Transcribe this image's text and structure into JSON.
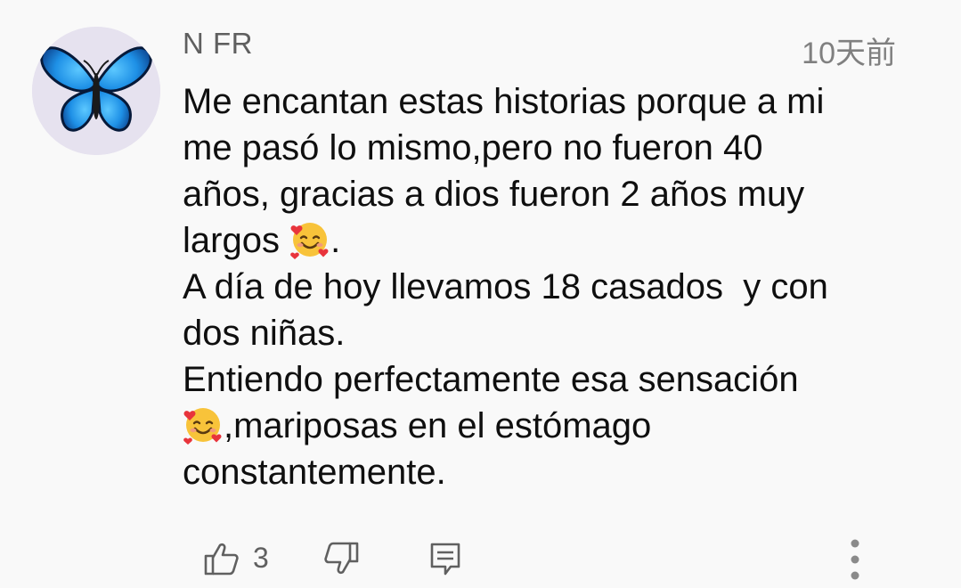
{
  "comment": {
    "author": "N FR",
    "timestamp": "10天前",
    "text_lines": [
      "Me encantan estas historias porque a mi",
      "me pasó lo mismo,pero no fueron 40",
      "años, gracias a dios fueron 2 años muy",
      "largos",
      ".",
      "A día de hoy llevamos 18 casados  y con",
      "dos niñas.",
      "Entiendo perfectamente esa sensación",
      ",mariposas en el estómago",
      "constantemente."
    ],
    "emoji": "smiling-face-with-hearts",
    "likes": "3"
  },
  "icons": {
    "avatar": "blue-butterfly",
    "like": "thumbs-up-icon",
    "dislike": "thumbs-down-icon",
    "reply": "reply-comment-icon",
    "more": "more-vertical-icon"
  },
  "colors": {
    "background": "#f9f9f9",
    "text": "#0f0f0f",
    "author": "#5f5f5f",
    "meta": "#808080",
    "butterfly": "#1f8fe0"
  }
}
